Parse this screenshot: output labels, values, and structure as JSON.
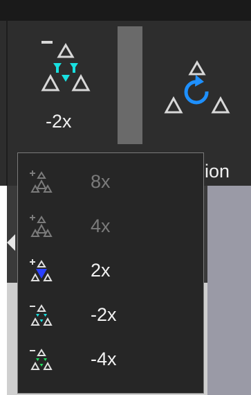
{
  "toolbar": {
    "speed_button_label": "-2x",
    "rotation_label_partial": "ion"
  },
  "menu": {
    "items": [
      {
        "label": "8x",
        "sign": "+",
        "enabled": false
      },
      {
        "label": "4x",
        "sign": "+",
        "enabled": false
      },
      {
        "label": "2x",
        "sign": "+",
        "enabled": true
      },
      {
        "label": "-2x",
        "sign": "-",
        "enabled": true
      },
      {
        "label": "-4x",
        "sign": "-",
        "enabled": true
      }
    ]
  },
  "colors": {
    "toolbar_bg": "#2d2d2d",
    "menu_bg": "#262626",
    "cyan_accent": "#18e0e0",
    "blue_accent": "#2a40ff",
    "green_accent": "#20e060",
    "rotate_blue": "#1e90ff"
  },
  "icons": {
    "speed_button": "minus-triangle-cyan-icon",
    "rotation_button": "rotate-triangle-icon",
    "submenu_arrow": "chevron-left-icon"
  }
}
